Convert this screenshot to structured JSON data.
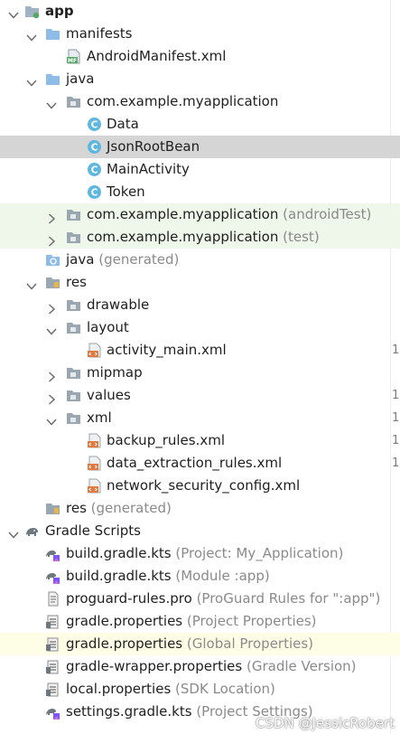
{
  "tree": [
    {
      "level": 0,
      "arrow": "down",
      "icon": "folder-module-icon",
      "name": "app",
      "bold": true
    },
    {
      "level": 1,
      "arrow": "down",
      "icon": "folder-icon",
      "name": "manifests"
    },
    {
      "level": 2,
      "arrow": "",
      "icon": "manifest-file-icon",
      "name": "AndroidManifest.xml"
    },
    {
      "level": 1,
      "arrow": "down",
      "icon": "folder-icon",
      "name": "java"
    },
    {
      "level": 2,
      "arrow": "down",
      "icon": "package-icon",
      "name": "com.example.myapplication"
    },
    {
      "level": 3,
      "arrow": "",
      "icon": "class-icon",
      "name": "Data"
    },
    {
      "level": 3,
      "arrow": "",
      "icon": "class-icon",
      "name": "JsonRootBean",
      "selected": true
    },
    {
      "level": 3,
      "arrow": "",
      "icon": "class-icon",
      "name": "MainActivity"
    },
    {
      "level": 3,
      "arrow": "",
      "icon": "class-icon",
      "name": "Token"
    },
    {
      "level": 2,
      "arrow": "right",
      "icon": "package-icon",
      "name": "com.example.myapplication",
      "hint": "(androidTest)",
      "bg": "green"
    },
    {
      "level": 2,
      "arrow": "right",
      "icon": "package-icon",
      "name": "com.example.myapplication",
      "hint": "(test)",
      "bg": "green"
    },
    {
      "level": 1,
      "arrow": "",
      "icon": "generated-folder-icon",
      "name": "java",
      "hint": "(generated)"
    },
    {
      "level": 1,
      "arrow": "down",
      "icon": "res-folder-icon",
      "name": "res"
    },
    {
      "level": 2,
      "arrow": "right",
      "icon": "package-icon",
      "name": "drawable"
    },
    {
      "level": 2,
      "arrow": "down",
      "icon": "package-icon",
      "name": "layout"
    },
    {
      "level": 3,
      "arrow": "",
      "icon": "xml-file-icon",
      "name": "activity_main.xml"
    },
    {
      "level": 2,
      "arrow": "right",
      "icon": "package-icon",
      "name": "mipmap"
    },
    {
      "level": 2,
      "arrow": "right",
      "icon": "package-icon",
      "name": "values"
    },
    {
      "level": 2,
      "arrow": "down",
      "icon": "package-icon",
      "name": "xml"
    },
    {
      "level": 3,
      "arrow": "",
      "icon": "xml-file-icon",
      "name": "backup_rules.xml"
    },
    {
      "level": 3,
      "arrow": "",
      "icon": "xml-file-icon",
      "name": "data_extraction_rules.xml"
    },
    {
      "level": 3,
      "arrow": "",
      "icon": "xml-file-icon",
      "name": "network_security_config.xml"
    },
    {
      "level": 1,
      "arrow": "",
      "icon": "res-folder-icon",
      "name": "res",
      "hint": "(generated)"
    },
    {
      "level": 0,
      "arrow": "down",
      "icon": "gradle-elephant-icon",
      "name": "Gradle Scripts"
    },
    {
      "level": 1,
      "arrow": "",
      "icon": "gradle-kts-icon",
      "name": "build.gradle.kts",
      "hint": "(Project: My_Application)"
    },
    {
      "level": 1,
      "arrow": "",
      "icon": "gradle-kts-icon",
      "name": "build.gradle.kts",
      "hint": "(Module :app)"
    },
    {
      "level": 1,
      "arrow": "",
      "icon": "text-file-icon",
      "name": "proguard-rules.pro",
      "hint": "(ProGuard Rules for \":app\")"
    },
    {
      "level": 1,
      "arrow": "",
      "icon": "properties-file-icon",
      "name": "gradle.properties",
      "hint": "(Project Properties)"
    },
    {
      "level": 1,
      "arrow": "",
      "icon": "properties-file-icon",
      "name": "gradle.properties",
      "hint": "(Global Properties)",
      "bg": "yellow"
    },
    {
      "level": 1,
      "arrow": "",
      "icon": "properties-file-icon",
      "name": "gradle-wrapper.properties",
      "hint": "(Gradle Version)"
    },
    {
      "level": 1,
      "arrow": "",
      "icon": "properties-file-icon",
      "name": "local.properties",
      "hint": "(SDK Location)"
    },
    {
      "level": 1,
      "arrow": "",
      "icon": "gradle-kts-icon",
      "name": "settings.gradle.kts",
      "hint": "(Project Settings)"
    }
  ],
  "gutter": [
    {
      "row": 15,
      "text": "1"
    },
    {
      "row": 17,
      "text": "1"
    },
    {
      "row": 18,
      "text": "1"
    },
    {
      "row": 19,
      "text": "1"
    },
    {
      "row": 20,
      "text": "1"
    }
  ],
  "watermark": "CSDN @JessicRobert",
  "colors": {
    "folder": "#8fbce6",
    "package": "#9aa7b0",
    "class": "#5fb7e0",
    "xml": "#e07a3f",
    "module_dot": "#59a869",
    "selected_bg": "#d5d5d5",
    "green_bg": "#eef7ea",
    "yellow_bg": "#fefde6"
  }
}
